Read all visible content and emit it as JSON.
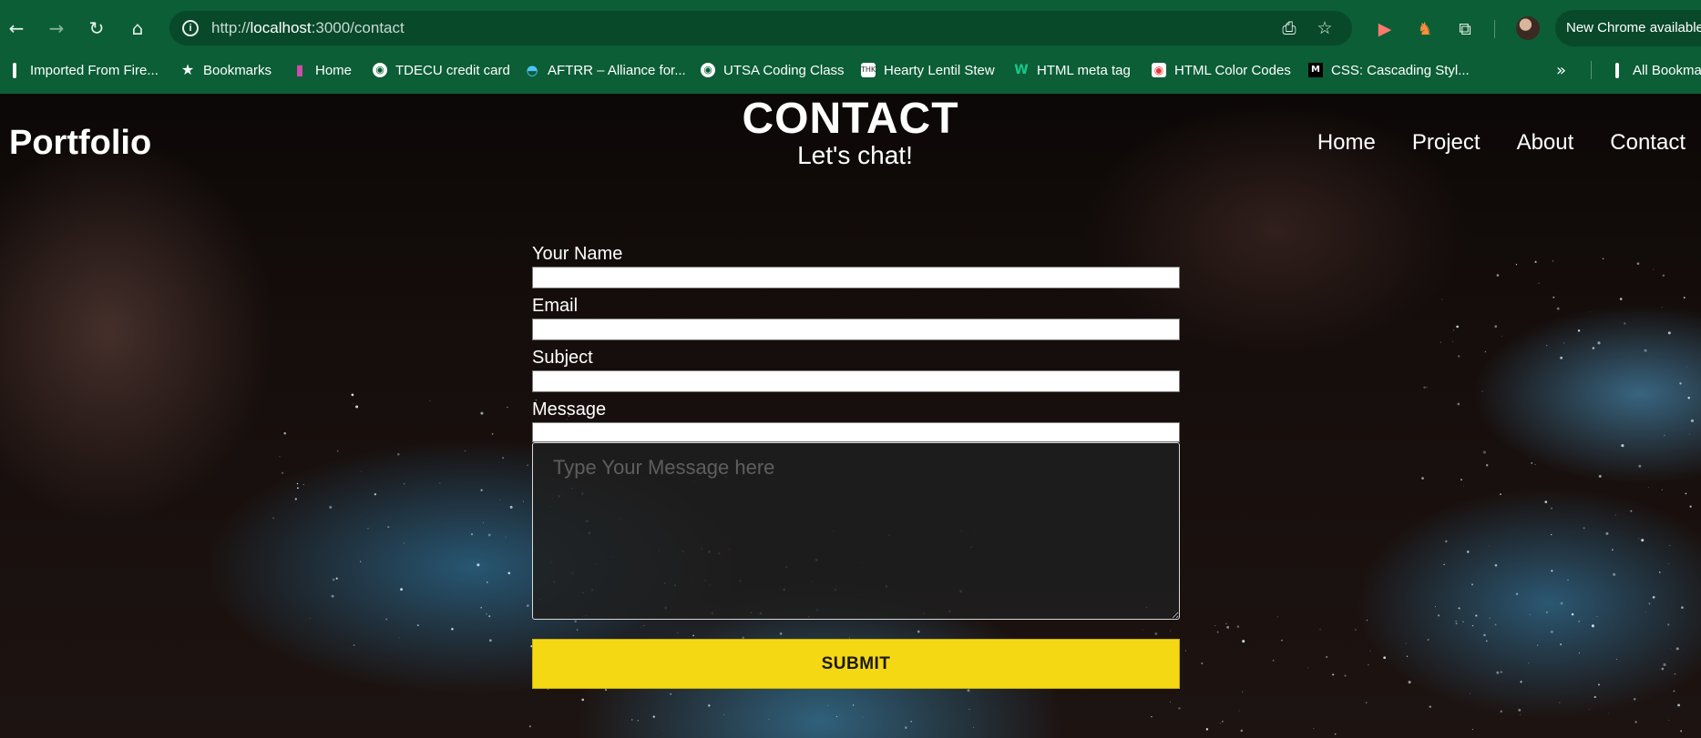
{
  "browser": {
    "url_prefix": "http://",
    "url_host": "localhost",
    "url_path": ":3000/contact",
    "update_label": "New Chrome available",
    "theme_color": "#0b5e36",
    "bookmarks": [
      {
        "label": "Imported From Fire...",
        "icon": "folder-icon"
      },
      {
        "label": "Bookmarks",
        "icon": "star-icon"
      },
      {
        "label": "Home",
        "icon": "bookmark-ribbon-icon"
      },
      {
        "label": "TDECU credit card",
        "icon": "globe-icon"
      },
      {
        "label": "AFTRR – Alliance for...",
        "icon": "aftrr-logo-icon"
      },
      {
        "label": "UTSA Coding Class",
        "icon": "globe-icon"
      },
      {
        "label": "Hearty Lentil Stew",
        "icon": "thk-logo-icon"
      },
      {
        "label": "HTML meta tag",
        "icon": "w-logo-icon"
      },
      {
        "label": "HTML Color Codes",
        "icon": "color-picker-icon"
      },
      {
        "label": "CSS: Cascading Styl...",
        "icon": "mdn-logo-icon"
      },
      {
        "label": "All Bookmarks",
        "icon": "folder-icon"
      }
    ]
  },
  "page": {
    "brand": "Portfolio",
    "title": "CONTACT",
    "subtitle": "Let's chat!",
    "nav": [
      "Home",
      "Project",
      "About",
      "Contact"
    ],
    "form": {
      "name_label": "Your Name",
      "email_label": "Email",
      "subject_label": "Subject",
      "message_label": "Message",
      "name_value": "",
      "email_value": "",
      "subject_value": "",
      "message_value": "",
      "message_placeholder": "Type Your Message here",
      "submit_label": "SUBMIT",
      "submit_color": "#f5d814"
    }
  }
}
